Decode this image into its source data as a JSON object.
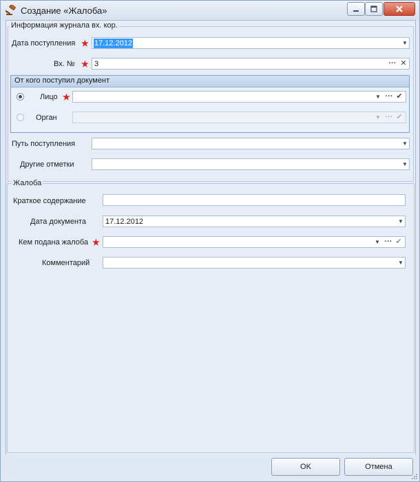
{
  "window": {
    "title": "Создание «Жалоба»",
    "title_icon": "gavel-icon"
  },
  "journal": {
    "group_label": "Информация журнала вх. кор.",
    "date_label": "Дата поступления",
    "date_value": "17.12.2012",
    "number_label": "Вх. №",
    "number_value": "3"
  },
  "source": {
    "header": "От кого поступил документ",
    "person_label": "Лицо",
    "person_value": "",
    "person_selected": true,
    "organ_label": "Орган",
    "organ_value": ""
  },
  "route": {
    "label": "Путь поступления",
    "value": ""
  },
  "other_marks": {
    "label": "Другие отметки",
    "value": ""
  },
  "complaint": {
    "group_label": "Жалоба",
    "summary_label": "Краткое содержание",
    "summary_value": "",
    "doc_date_label": "Дата документа",
    "doc_date_value": "17.12.2012",
    "filed_by_label": "Кем подана жалоба",
    "filed_by_value": "",
    "comment_label": "Комментарий",
    "comment_value": ""
  },
  "buttons": {
    "ok": "OK",
    "cancel": "Отмена"
  },
  "colors": {
    "required": "#e0211b",
    "selection": "#3399ff",
    "accent": "#7fa2cc"
  }
}
